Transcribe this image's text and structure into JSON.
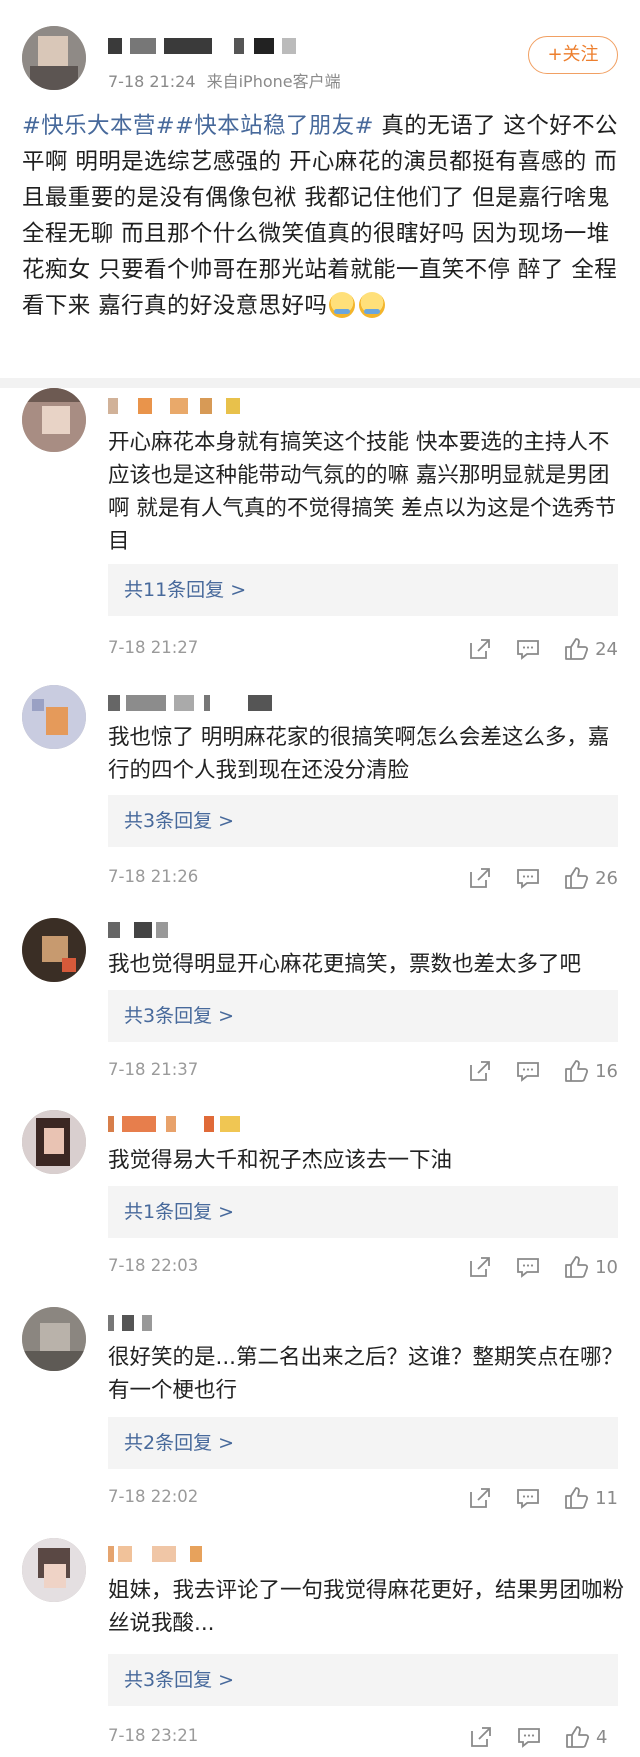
{
  "post": {
    "meta": {
      "time": "7-18 21:24",
      "source": "来自iPhone客户端"
    },
    "follow_label": "+关注",
    "body": {
      "topic1": "#快乐大本营#",
      "topic2": "#快本站稳了朋友#",
      "text": " 真的无语了 这个好不公平啊 明明是选综艺感强的 开心麻花的演员都挺有喜感的 而且最重要的是没有偶像包袱 我都记住他们了 但是嘉行啥鬼 全程无聊 而且那个什么微笑值真的很瞎好吗 因为现场一堆花痴女 只要看个帅哥在那光站着就能一直笑不停 醉了 全程看下来 嘉行真的好没意思好吗"
    }
  },
  "icons": {
    "share": "share-icon",
    "comment": "comment-icon",
    "like": "like-icon",
    "emoji": "shrug-emoji-icon"
  },
  "colors": {
    "link": "#47699b",
    "follow": "#ed7f2e"
  },
  "comments": [
    {
      "text": "开心麻花本身就有搞笑这个技能 快本要选的主持人不应该也是这种能带动气氛的的嘛 嘉兴那明显就是男团啊 就是有人气真的不觉得搞笑 差点以为这是个选秀节目",
      "replies": "共11条回复 >",
      "time": "7-18 21:27",
      "likes": "24"
    },
    {
      "text": "我也惊了 明明麻花家的很搞笑啊怎么会差这么多，嘉行的四个人我到现在还没分清脸",
      "replies": "共3条回复 >",
      "time": "7-18 21:26",
      "likes": "26"
    },
    {
      "text": "我也觉得明显开心麻花更搞笑，票数也差太多了吧",
      "replies": "共3条回复 >",
      "time": "7-18 21:37",
      "likes": "16"
    },
    {
      "text": "我觉得易大千和祝子杰应该去一下油",
      "replies": "共1条回复 >",
      "time": "7-18 22:03",
      "likes": "10"
    },
    {
      "text": "很好笑的是...第二名出来之后？这谁？整期笑点在哪？有一个梗也行",
      "replies": "共2条回复 >",
      "time": "7-18 22:02",
      "likes": "11"
    },
    {
      "text": "姐妹，我去评论了一句我觉得麻花更好，结果男团咖粉丝说我酸...",
      "replies": "共3条回复 >",
      "time": "7-18 23:21",
      "likes": "4"
    }
  ]
}
